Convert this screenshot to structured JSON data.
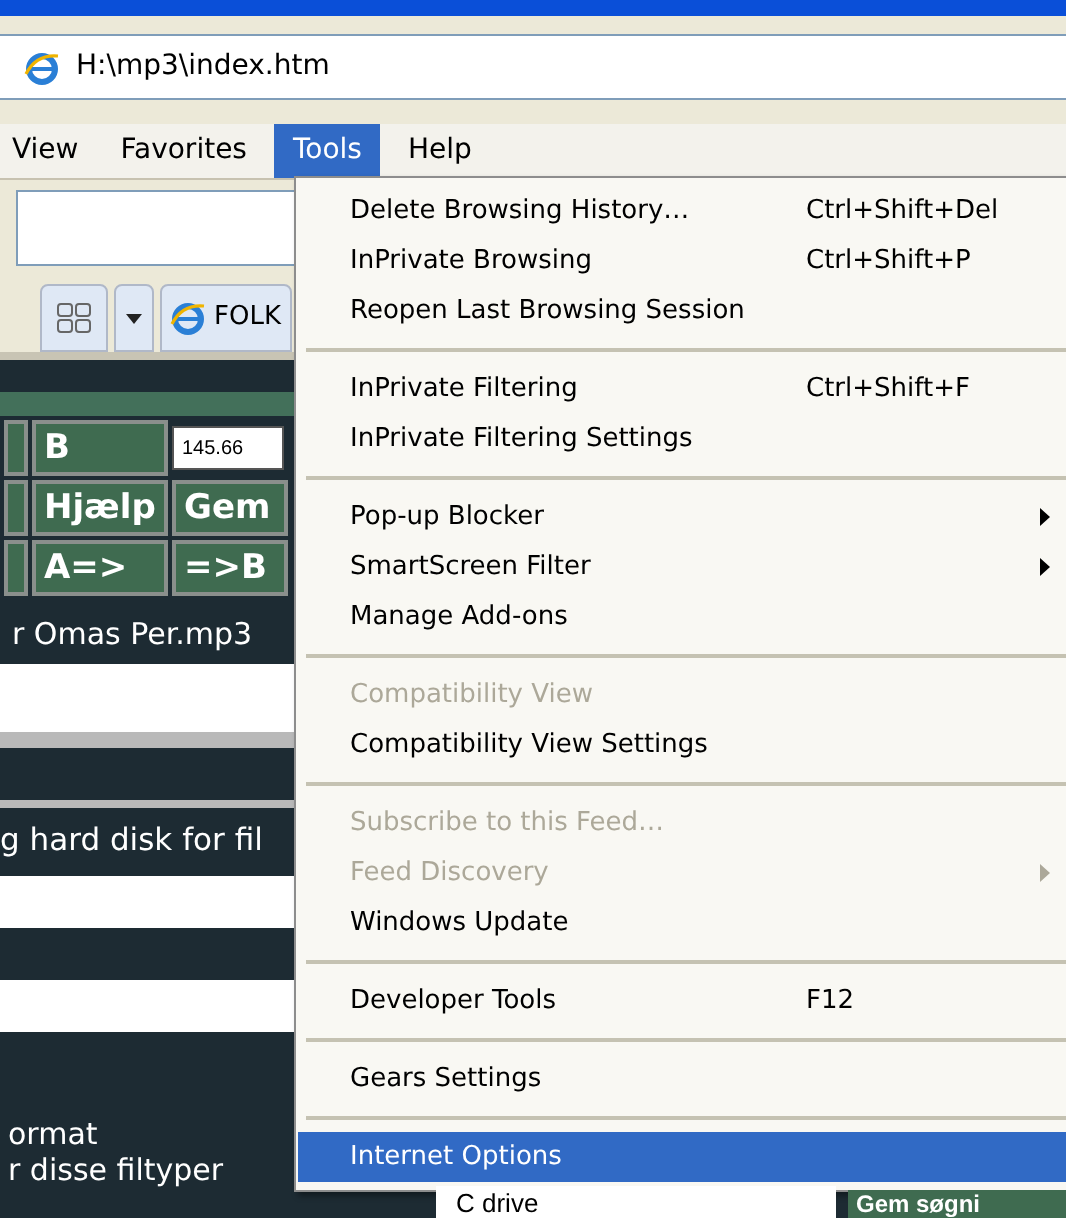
{
  "address_bar": {
    "value": "H:\\mp3\\index.htm"
  },
  "menu_bar": [
    {
      "label": "View",
      "selected": false
    },
    {
      "label": "Favorites",
      "selected": false
    },
    {
      "label": "Tools",
      "selected": true
    },
    {
      "label": "Help",
      "selected": false
    }
  ],
  "tab_bar": {
    "tab_label": "FOLK"
  },
  "page": {
    "buttons": [
      {
        "label": "B",
        "kind": "button"
      },
      {
        "label": "145.66",
        "kind": "field"
      },
      {
        "label": "Hjælp",
        "kind": "button"
      },
      {
        "label": "Gem",
        "kind": "button"
      },
      {
        "label": "A=>",
        "kind": "button"
      },
      {
        "label": "=>B",
        "kind": "button"
      }
    ],
    "file_name": "r Omas Per.mp3",
    "status_text": "g hard disk for fil",
    "lines": [
      "ormat",
      "r disse filtyper"
    ],
    "drive_option": "C drive",
    "save_search_button": "Gem søgni"
  },
  "tools_menu": [
    {
      "kind": "item",
      "label": "Delete Browsing History…",
      "shortcut": "Ctrl+Shift+Del",
      "disabled": false,
      "submenu": false,
      "selected": false
    },
    {
      "kind": "item",
      "label": "InPrivate Browsing",
      "shortcut": "Ctrl+Shift+P",
      "disabled": false,
      "submenu": false,
      "selected": false
    },
    {
      "kind": "item",
      "label": "Reopen Last Browsing Session",
      "disabled": false,
      "submenu": false,
      "selected": false
    },
    {
      "kind": "separator"
    },
    {
      "kind": "item",
      "label": "InPrivate Filtering",
      "shortcut": "Ctrl+Shift+F",
      "disabled": false,
      "submenu": false,
      "selected": false
    },
    {
      "kind": "item",
      "label": "InPrivate Filtering Settings",
      "disabled": false,
      "submenu": false,
      "selected": false
    },
    {
      "kind": "separator"
    },
    {
      "kind": "item",
      "label": "Pop-up Blocker",
      "disabled": false,
      "submenu": true,
      "selected": false
    },
    {
      "kind": "item",
      "label": "SmartScreen Filter",
      "disabled": false,
      "submenu": true,
      "selected": false
    },
    {
      "kind": "item",
      "label": "Manage Add-ons",
      "disabled": false,
      "submenu": false,
      "selected": false
    },
    {
      "kind": "separator"
    },
    {
      "kind": "item",
      "label": "Compatibility View",
      "disabled": true,
      "submenu": false,
      "selected": false
    },
    {
      "kind": "item",
      "label": "Compatibility View Settings",
      "disabled": false,
      "submenu": false,
      "selected": false
    },
    {
      "kind": "separator"
    },
    {
      "kind": "item",
      "label": "Subscribe to this Feed…",
      "disabled": true,
      "submenu": false,
      "selected": false
    },
    {
      "kind": "item",
      "label": "Feed Discovery",
      "disabled": true,
      "submenu": true,
      "selected": false
    },
    {
      "kind": "item",
      "label": "Windows Update",
      "disabled": false,
      "submenu": false,
      "selected": false
    },
    {
      "kind": "separator"
    },
    {
      "kind": "item",
      "label": "Developer Tools",
      "shortcut": "F12",
      "disabled": false,
      "submenu": false,
      "selected": false
    },
    {
      "kind": "separator"
    },
    {
      "kind": "item",
      "label": "Gears Settings",
      "disabled": false,
      "submenu": false,
      "selected": false
    },
    {
      "kind": "separator"
    },
    {
      "kind": "item",
      "label": "Internet Options",
      "disabled": false,
      "submenu": false,
      "selected": true
    }
  ]
}
